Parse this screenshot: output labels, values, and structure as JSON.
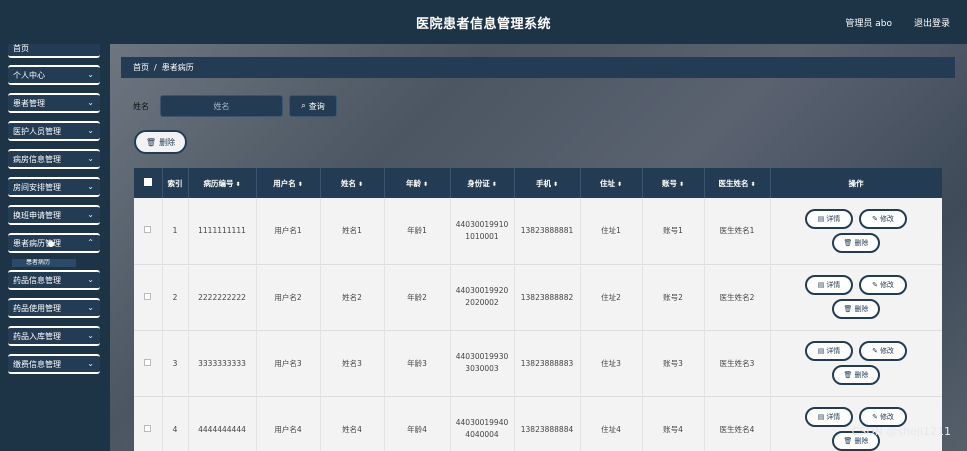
{
  "header": {
    "title": "医院患者信息管理系统",
    "user": "管理员 abo",
    "logout": "退出登录"
  },
  "sidebar": {
    "items": [
      {
        "label": "首页"
      },
      {
        "label": "个人中心"
      },
      {
        "label": "患者管理"
      },
      {
        "label": "医护人员管理"
      },
      {
        "label": "病房信息管理"
      },
      {
        "label": "房间安排管理"
      },
      {
        "label": "换班申请管理"
      },
      {
        "label": "患者病历管理"
      },
      {
        "label": "药品信息管理"
      },
      {
        "label": "药品使用管理"
      },
      {
        "label": "药品入库管理"
      },
      {
        "label": "缴费信息管理"
      }
    ],
    "submenu": "患者病历"
  },
  "breadcrumb": {
    "home": "首页",
    "sep": "/",
    "current": "患者病历"
  },
  "search": {
    "label": "姓名",
    "placeholder": "姓名",
    "button": "查询"
  },
  "actions": {
    "delete": "删除"
  },
  "table": {
    "headers": [
      "索引",
      "病历编号",
      "用户名",
      "姓名",
      "年龄",
      "身份证",
      "手机",
      "住址",
      "账号",
      "医生姓名",
      "操作"
    ],
    "rows": [
      {
        "index": "1",
        "record_no": "1111111111",
        "username": "用户名1",
        "name": "姓名1",
        "age": "年龄1",
        "id_line1": "44030019910",
        "id_line2": "1010001",
        "phone": "13823888881",
        "address": "住址1",
        "account": "账号1",
        "doctor": "医生姓名1"
      },
      {
        "index": "2",
        "record_no": "2222222222",
        "username": "用户名2",
        "name": "姓名2",
        "age": "年龄2",
        "id_line1": "44030019920",
        "id_line2": "2020002",
        "phone": "13823888882",
        "address": "住址2",
        "account": "账号2",
        "doctor": "医生姓名2"
      },
      {
        "index": "3",
        "record_no": "3333333333",
        "username": "用户名3",
        "name": "姓名3",
        "age": "年龄3",
        "id_line1": "44030019930",
        "id_line2": "3030003",
        "phone": "13823888883",
        "address": "住址3",
        "account": "账号3",
        "doctor": "医生姓名3"
      },
      {
        "index": "4",
        "record_no": "4444444444",
        "username": "用户名4",
        "name": "姓名4",
        "age": "年龄4",
        "id_line1": "44030019940",
        "id_line2": "4040004",
        "phone": "13823888884",
        "address": "住址4",
        "account": "账号4",
        "doctor": "医生姓名4"
      }
    ],
    "op_detail": "详情",
    "op_edit": "修改",
    "op_delete": "删除"
  },
  "watermark": "CSDN @sheji1211"
}
